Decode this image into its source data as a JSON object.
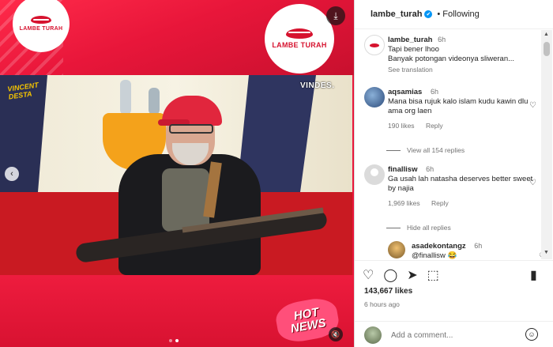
{
  "media": {
    "brand_text": "LAMBE TURAH",
    "brand_text_right": "LAMBE TURAH",
    "show_logo_line1": "VINCENT",
    "show_logo_line2": "DESTA",
    "network_logo": "VINDES.",
    "hot_news_line1": "HOT",
    "hot_news_line2": "NEWS",
    "slides": 2,
    "active_slide": 2,
    "colors": {
      "brand_red": "#e8163a",
      "logo_red": "#d6132f",
      "cap_red": "#e1263d"
    },
    "icons": [
      "download-icon",
      "chevron-left-icon",
      "speaker-muted-icon"
    ]
  },
  "header": {
    "username": "lambe_turah",
    "verified_glyph": "✔",
    "separator": "•",
    "follow_status": "Following"
  },
  "caption": {
    "username": "lambe_turah",
    "time": "6h",
    "line1": "Tapi bener lhoo",
    "line2": "Banyak potongan videonya sliweran...",
    "see_translation": "See translation"
  },
  "comments": [
    {
      "username": "aqsamias",
      "time": "6h",
      "text": "Mana bisa rujuk kalo islam kudu kawin dlu ama org laen",
      "likes": "190 likes",
      "reply": "Reply",
      "view_replies": "View all 154 replies"
    },
    {
      "username": "finallisw",
      "time": "6h",
      "text": "Ga usah lah natasha deserves better sweet by najia",
      "likes": "1,969 likes",
      "reply": "Reply",
      "view_replies": "Hide all replies"
    },
    {
      "username": "asadekontangz",
      "time": "6h",
      "text": "@finallisw 😂"
    }
  ],
  "actions": {
    "likes": "143,667 likes",
    "time_ago": "6 hours ago",
    "comment_placeholder": "Add a comment...",
    "icons": [
      "heart-icon",
      "comment-icon",
      "share-icon",
      "gift-icon",
      "bookmark-icon",
      "emoji-icon"
    ]
  },
  "glyphs": {
    "download": "⤓",
    "prev": "‹",
    "mute": "🔇",
    "heart": "♡",
    "comment": "◯",
    "share": "➤",
    "gift": "⬚",
    "bookmark": "▮",
    "emoji": "☺",
    "scroll_up": "▲",
    "scroll_down": "▼"
  }
}
